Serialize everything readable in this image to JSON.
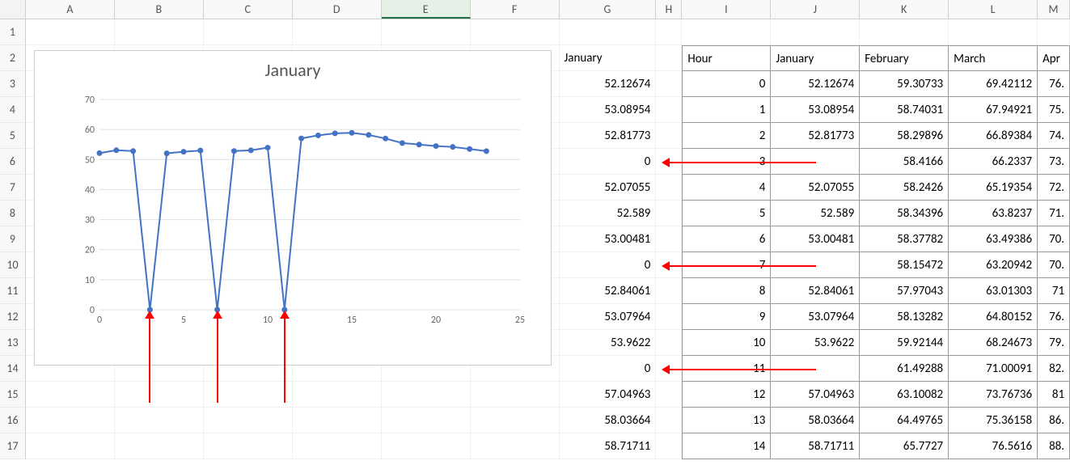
{
  "columns": {
    "A": 110,
    "B": 110,
    "C": 110,
    "D": 110,
    "E": 110,
    "F": 110,
    "G": 120,
    "H": 32,
    "I": 110,
    "J": 110,
    "K": 110,
    "L": 110,
    "M": 40
  },
  "selectedColumn": "E",
  "rowCount": 17,
  "cells": {
    "G2": "January",
    "G3": "52.12674",
    "G4": "53.08954",
    "G5": "52.81773",
    "G6": "0",
    "G7": "52.07055",
    "G8": "52.589",
    "G9": "53.00481",
    "G10": "0",
    "G11": "52.84061",
    "G12": "53.07964",
    "G13": "53.9622",
    "G14": "0",
    "G15": "57.04963",
    "G16": "58.03664",
    "G17": "58.71711",
    "I2": "Hour",
    "J2": "January",
    "K2": "February",
    "L2": "March",
    "M2": "Apr",
    "I3": "0",
    "J3": "52.12674",
    "K3": "59.30733",
    "L3": "69.42112",
    "M3": "76.",
    "I4": "1",
    "J4": "53.08954",
    "K4": "58.74031",
    "L4": "67.94921",
    "M4": "75.",
    "I5": "2",
    "J5": "52.81773",
    "K5": "58.29896",
    "L5": "66.89384",
    "M5": "74.",
    "I6": "3",
    "J6": "",
    "K6": "58.4166",
    "L6": "66.2337",
    "M6": "73.",
    "I7": "4",
    "J7": "52.07055",
    "K7": "58.2426",
    "L7": "65.19354",
    "M7": "72.",
    "I8": "5",
    "J8": "52.589",
    "K8": "58.34396",
    "L8": "63.8237",
    "M8": "71.",
    "I9": "6",
    "J9": "53.00481",
    "K9": "58.37782",
    "L9": "63.49386",
    "M9": "70.",
    "I10": "7",
    "J10": "",
    "K10": "58.15472",
    "L10": "63.20942",
    "M10": "70.",
    "I11": "8",
    "J11": "52.84061",
    "K11": "57.97043",
    "L11": "63.01303",
    "M11": "71",
    "I12": "9",
    "J12": "53.07964",
    "K12": "58.13282",
    "L12": "64.80152",
    "M12": "76.",
    "I13": "10",
    "J13": "53.9622",
    "K13": "59.92144",
    "L13": "68.24673",
    "M13": "79.",
    "I14": "11",
    "J14": "",
    "K14": "61.49288",
    "L14": "71.00091",
    "M14": "82.",
    "I15": "12",
    "J15": "57.04963",
    "K15": "63.10082",
    "L15": "73.76736",
    "M15": "81",
    "I16": "13",
    "J16": "58.03664",
    "K16": "64.49765",
    "L16": "75.36158",
    "M16": "86.",
    "I17": "14",
    "J17": "58.71711",
    "K17": "65.7727",
    "L17": "76.5616",
    "M17": "88."
  },
  "numericCells": [
    "G3",
    "G4",
    "G5",
    "G6",
    "G7",
    "G8",
    "G9",
    "G10",
    "G11",
    "G12",
    "G13",
    "G14",
    "G15",
    "G16",
    "G17",
    "I3",
    "I4",
    "I5",
    "I6",
    "I7",
    "I8",
    "I9",
    "I10",
    "I11",
    "I12",
    "I13",
    "I14",
    "I15",
    "I16",
    "I17",
    "J3",
    "J4",
    "J5",
    "J7",
    "J8",
    "J9",
    "J11",
    "J12",
    "J13",
    "J15",
    "J16",
    "J17",
    "K3",
    "K4",
    "K5",
    "K6",
    "K7",
    "K8",
    "K9",
    "K10",
    "K11",
    "K12",
    "K13",
    "K14",
    "K15",
    "K16",
    "K17",
    "L3",
    "L4",
    "L5",
    "L6",
    "L7",
    "L8",
    "L9",
    "L10",
    "L11",
    "L12",
    "L13",
    "L14",
    "L15",
    "L16",
    "L17",
    "M3",
    "M4",
    "M5",
    "M6",
    "M7",
    "M8",
    "M9",
    "M10",
    "M11",
    "M12",
    "M13",
    "M14",
    "M15",
    "M16",
    "M17"
  ],
  "borderedRegion": {
    "cols": [
      "I",
      "J",
      "K",
      "L",
      "M"
    ],
    "rowStart": 2,
    "rowEnd": 17
  },
  "chart": {
    "title": "January",
    "position": {
      "colStart": "A",
      "rowStart": 2,
      "colEnd": "F",
      "rowEnd": 14
    }
  },
  "chart_data": {
    "type": "line",
    "title": "January",
    "xlabel": "",
    "ylabel": "",
    "xlim": [
      0,
      25
    ],
    "ylim": [
      0,
      70
    ],
    "xticks": [
      0,
      5,
      10,
      15,
      20,
      25
    ],
    "yticks": [
      0,
      10,
      20,
      30,
      40,
      50,
      60,
      70
    ],
    "x": [
      0,
      1,
      2,
      3,
      4,
      5,
      6,
      7,
      8,
      9,
      10,
      11,
      12,
      13,
      14,
      15,
      16,
      17,
      18,
      19,
      20,
      21,
      22,
      23
    ],
    "series": [
      {
        "name": "January",
        "values": [
          52.13,
          53.09,
          52.82,
          0,
          52.07,
          52.59,
          53.0,
          0,
          52.84,
          53.08,
          53.96,
          0,
          57.05,
          58.04,
          58.72,
          58.9,
          58.2,
          57.0,
          55.5,
          55.0,
          54.5,
          54.2,
          53.5,
          52.8
        ]
      }
    ],
    "markers": true,
    "color": "#4472C4"
  },
  "annotations": {
    "horizontalArrows": [
      {
        "pointsToCell": "G6",
        "fromCell": "J6"
      },
      {
        "pointsToCell": "G10",
        "fromCell": "J10"
      },
      {
        "pointsToCell": "G14",
        "fromCell": "J14"
      }
    ],
    "verticalArrows": [
      {
        "chartX": 3,
        "meaning": "zero-value dip at x=3"
      },
      {
        "chartX": 7,
        "meaning": "zero-value dip at x=7"
      },
      {
        "chartX": 11,
        "meaning": "zero-value dip at x=11"
      }
    ]
  }
}
